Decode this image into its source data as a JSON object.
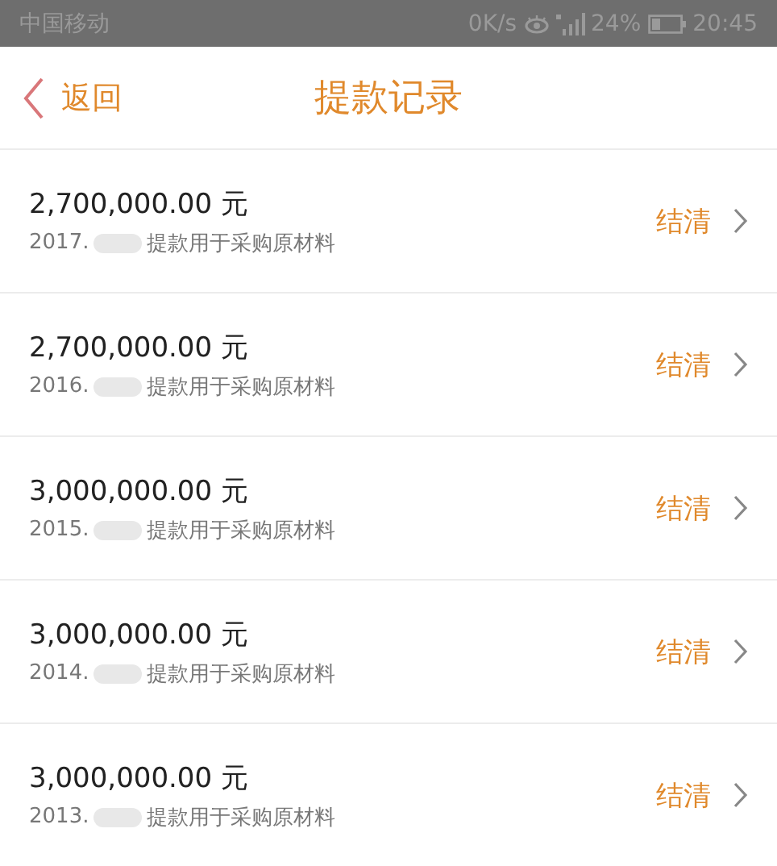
{
  "status_bar": {
    "carrier": "中国移动",
    "speed": "0K/s",
    "battery": "24%",
    "time": "20:45"
  },
  "nav": {
    "back": "返回",
    "title": "提款记录"
  },
  "records": [
    {
      "amount": "2,700,000.00 元",
      "date": "2017.",
      "note": "提款用于采购原材料",
      "status": "结清"
    },
    {
      "amount": "2,700,000.00 元",
      "date": "2016.",
      "note": "提款用于采购原材料",
      "status": "结清"
    },
    {
      "amount": "3,000,000.00 元",
      "date": "2015.",
      "note": "提款用于采购原材料",
      "status": "结清"
    },
    {
      "amount": "3,000,000.00 元",
      "date": "2014.",
      "note": "提款用于采购原材料",
      "status": "结清"
    },
    {
      "amount": "3,000,000.00 元",
      "date": "2013.",
      "note": "提款用于采购原材料",
      "status": "结清"
    }
  ]
}
